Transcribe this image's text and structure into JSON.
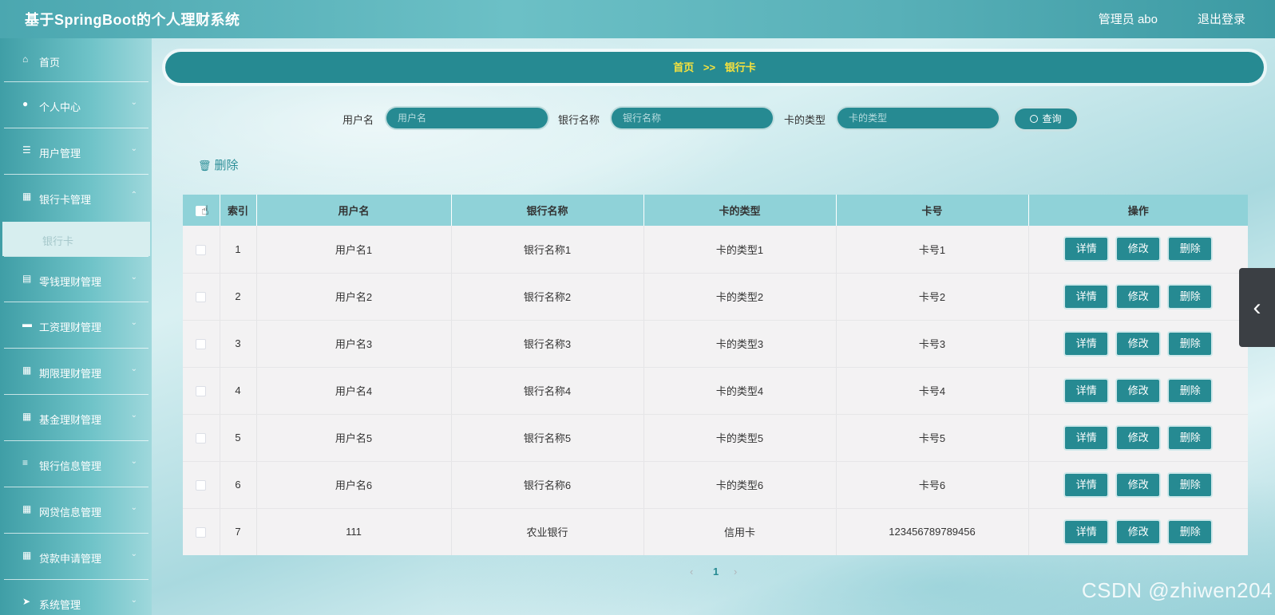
{
  "header": {
    "app_title": "基于SpringBoot的个人理财系统",
    "user_label": "管理员 abo",
    "logout_label": "退出登录"
  },
  "sidebar": {
    "items": [
      {
        "label": "首页",
        "icon": "home-icon"
      },
      {
        "label": "个人中心",
        "icon": "user-icon"
      },
      {
        "label": "用户管理",
        "icon": "sliders-icon"
      },
      {
        "label": "银行卡管理",
        "icon": "grid-icon"
      },
      {
        "label": "零钱理财管理",
        "icon": "clipboard-icon"
      },
      {
        "label": "工资理财管理",
        "icon": "ticket-icon"
      },
      {
        "label": "期限理财管理",
        "icon": "grid-icon"
      },
      {
        "label": "基金理财管理",
        "icon": "grid-icon"
      },
      {
        "label": "银行信息管理",
        "icon": "list-icon"
      },
      {
        "label": "网贷信息管理",
        "icon": "grid-icon"
      },
      {
        "label": "贷款申请管理",
        "icon": "grid-icon"
      },
      {
        "label": "系统管理",
        "icon": "send-icon"
      }
    ],
    "submenu_label": "银行卡"
  },
  "breadcrumb": {
    "home": "首页",
    "separator": ">>",
    "current": "银行卡"
  },
  "search": {
    "username_label": "用户名",
    "username_placeholder": "用户名",
    "bank_label": "银行名称",
    "bank_placeholder": "银行名称",
    "cardtype_label": "卡的类型",
    "cardtype_placeholder": "卡的类型",
    "query_label": "查询"
  },
  "bulk_delete_label": "删除",
  "table": {
    "headers": [
      "索引",
      "用户名",
      "银行名称",
      "卡的类型",
      "卡号",
      "操作"
    ],
    "rows": [
      {
        "index": "1",
        "username": "用户名1",
        "bank": "银行名称1",
        "type": "卡的类型1",
        "card": "卡号1"
      },
      {
        "index": "2",
        "username": "用户名2",
        "bank": "银行名称2",
        "type": "卡的类型2",
        "card": "卡号2"
      },
      {
        "index": "3",
        "username": "用户名3",
        "bank": "银行名称3",
        "type": "卡的类型3",
        "card": "卡号3"
      },
      {
        "index": "4",
        "username": "用户名4",
        "bank": "银行名称4",
        "type": "卡的类型4",
        "card": "卡号4"
      },
      {
        "index": "5",
        "username": "用户名5",
        "bank": "银行名称5",
        "type": "卡的类型5",
        "card": "卡号5"
      },
      {
        "index": "6",
        "username": "用户名6",
        "bank": "银行名称6",
        "type": "卡的类型6",
        "card": "卡号6"
      },
      {
        "index": "7",
        "username": "111",
        "bank": "农业银行",
        "type": "信用卡",
        "card": "123456789789456"
      }
    ],
    "actions": {
      "detail": "详情",
      "edit": "修改",
      "delete": "删除"
    }
  },
  "pagination": {
    "prev": "‹",
    "current": "1",
    "next": "›"
  },
  "watermark": "CSDN @zhiwen204",
  "colors": {
    "primary": "#268a92",
    "header_bg": "#4ba7b0",
    "breadcrumb_text": "#f7e23d",
    "table_header": "#8fd2d8"
  }
}
